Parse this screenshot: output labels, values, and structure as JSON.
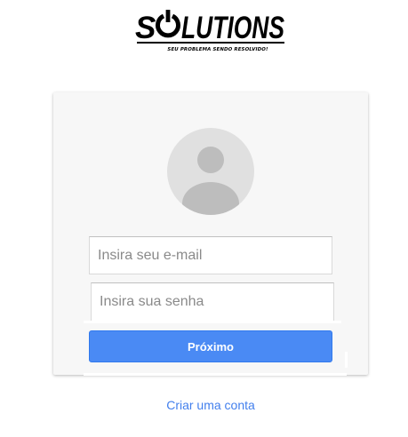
{
  "logo": {
    "text_left": "S",
    "text_right": "LUTIONS",
    "tagline": "SEU PROBLEMA SENDO RESOLVIDO!"
  },
  "login": {
    "email_placeholder": "Insira seu e-mail",
    "password_placeholder": "Insira sua senha",
    "next_label": "Próximo"
  },
  "footer": {
    "create_account_label": "Criar uma conta"
  },
  "icons": {
    "avatar": "default-user-icon",
    "logo_o": "power-icon"
  },
  "colors": {
    "primary_button": "#4a8af4",
    "link": "#427fed",
    "card_background": "#f7f7f7",
    "avatar_background": "#e0e0e0",
    "avatar_figure": "#bdbdbd"
  }
}
